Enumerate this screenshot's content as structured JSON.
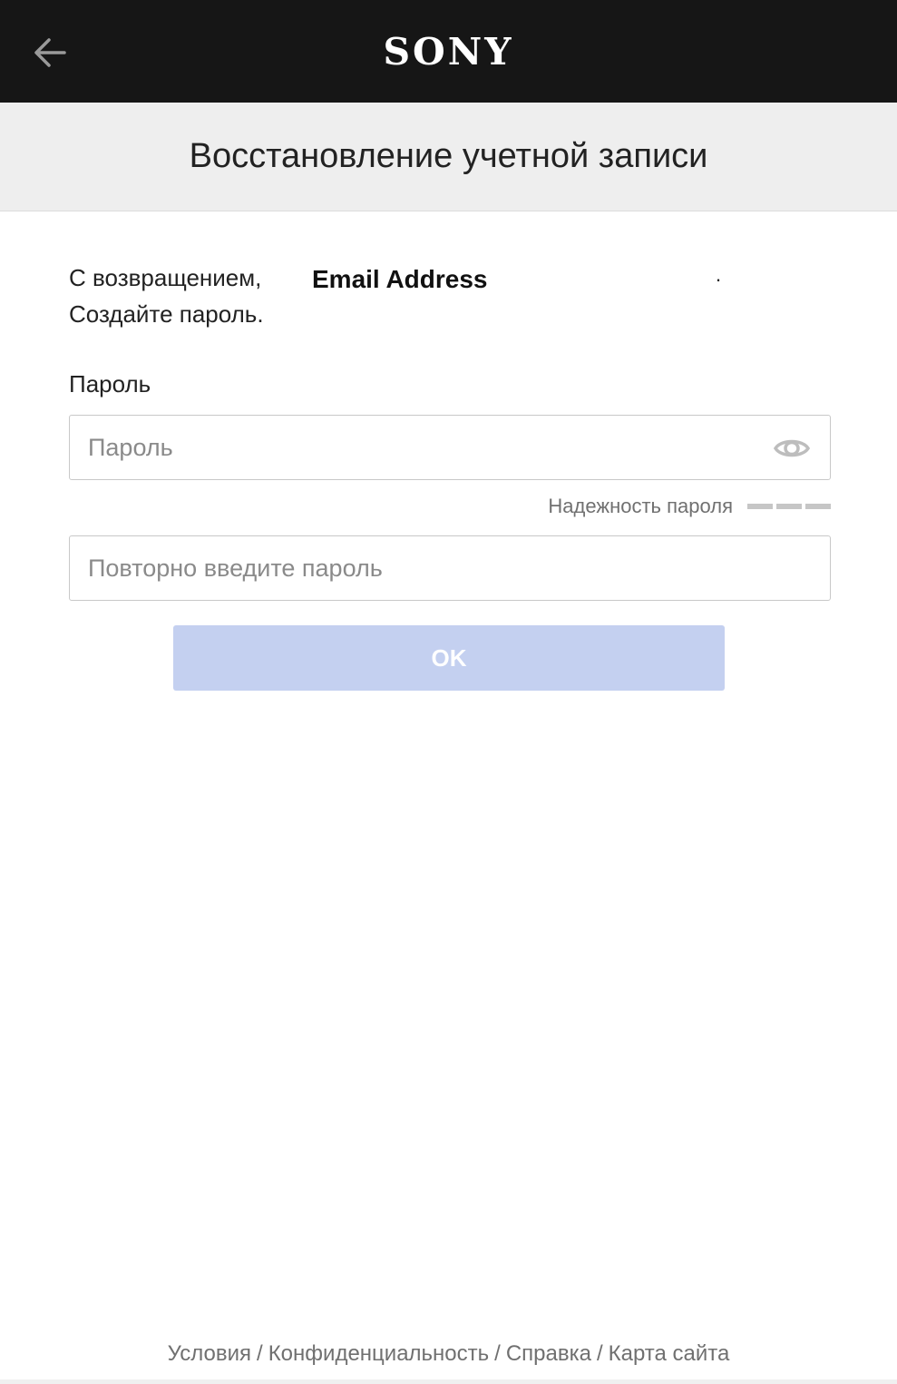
{
  "header": {
    "back_icon": "arrow-left-icon",
    "logo_text": "SONY"
  },
  "title": "Восстановление учетной записи",
  "welcome": {
    "line1": "С возвращением,",
    "line2": "Создайте пароль.",
    "email": "Email Address",
    "trailing": "."
  },
  "password": {
    "label": "Пароль",
    "placeholder": "Пароль",
    "value": "",
    "toggle_icon": "eye-icon"
  },
  "strength": {
    "label": "Надежность пароля",
    "segments": 3
  },
  "confirm": {
    "placeholder": "Повторно введите пароль",
    "value": ""
  },
  "submit_label": "OK",
  "footer": {
    "links": [
      "Условия",
      "Конфиденциальность",
      "Справка",
      "Карта сайта"
    ],
    "separator": "/"
  },
  "colors": {
    "header_bg": "#161616",
    "title_band_bg": "#eeeeee",
    "button_disabled_bg": "#c4d0f0"
  }
}
